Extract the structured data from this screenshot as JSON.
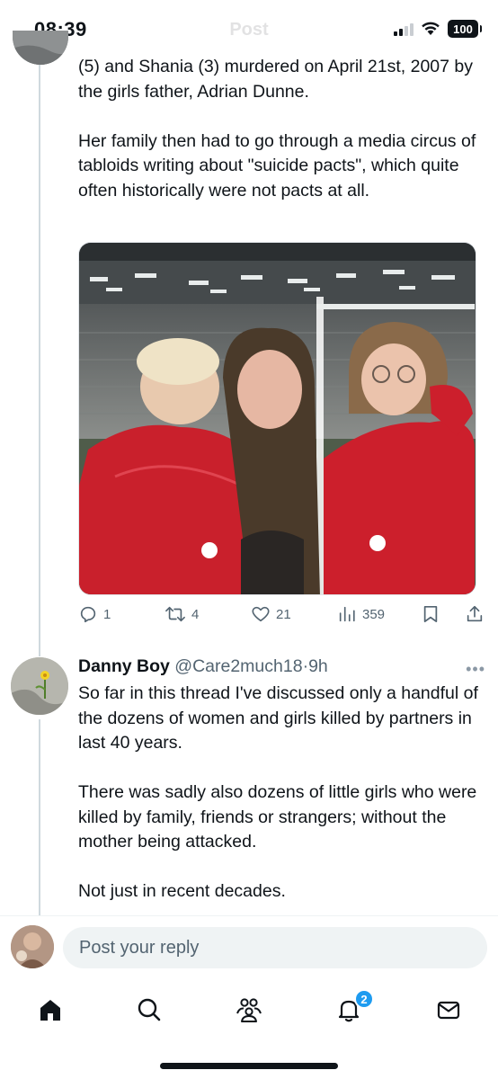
{
  "status_bar": {
    "time": "08:39",
    "battery": "100"
  },
  "header": {
    "title": "Post"
  },
  "tweet1": {
    "paragraphs": [
      "(5) and Shania (3) murdered on April 21st, 2007 by the girls father, Adrian Dunne.",
      "Her family then had to go through a media circus of tabloids writing about \"suicide pacts\", which quite often historically were not pacts at all."
    ],
    "image_alt": "Photo of a woman with two young girls in red coats",
    "stats": {
      "replies": "1",
      "reposts": "4",
      "likes": "21",
      "views": "359"
    }
  },
  "tweet2": {
    "name": "Danny Boy",
    "handle": "@Care2much18",
    "separator": "·",
    "time": "9h",
    "paragraphs": [
      "So far in this thread I've discussed only a handful of the dozens of women and girls killed by partners in last 40 years.",
      "There was sadly also dozens of little girls who were killed by family, friends or strangers; without the mother being attacked.",
      "Not just in recent decades."
    ]
  },
  "reply": {
    "placeholder": "Post your reply"
  },
  "tabs": {
    "notifications_badge": "2"
  },
  "colors": {
    "accent": "#1d9bf0",
    "text": "#0f1419",
    "secondary": "#536471",
    "divider": "#eff3f4"
  }
}
